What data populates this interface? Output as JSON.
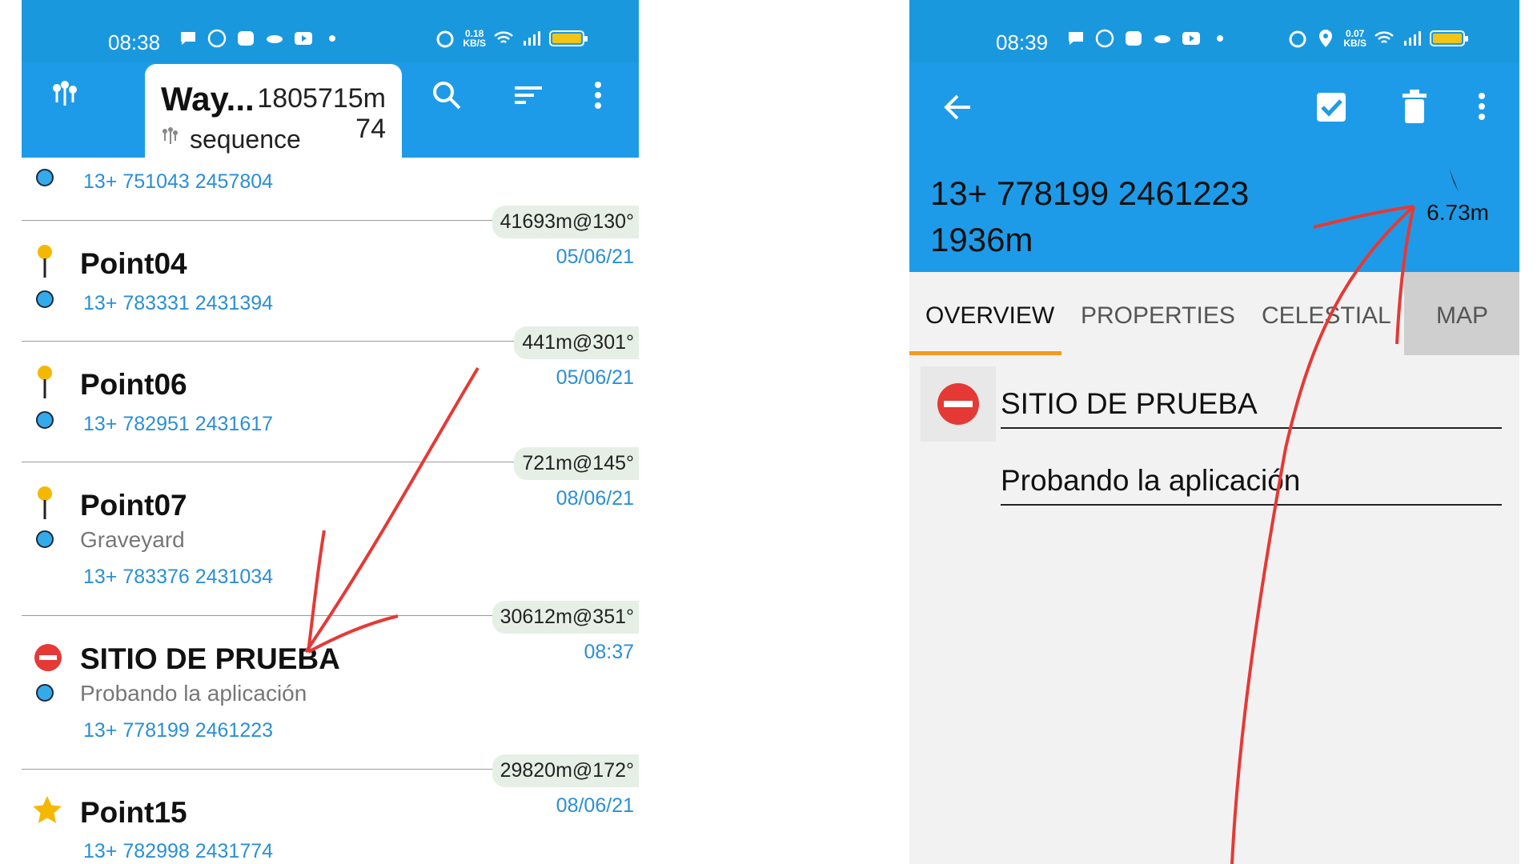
{
  "left": {
    "status": {
      "time": "08:38",
      "speed_top": "0.18",
      "speed_unit": "KB/S"
    },
    "appbar": {
      "title": "Way...",
      "distance": "1805715m",
      "subtitle": "sequence",
      "count": "74"
    },
    "first_coord": "13+ 751043 2457804",
    "rows": [
      {
        "bearing": "41693m@130°",
        "name": "Point04",
        "subtitle": "",
        "coord": "13+ 783331 2431394",
        "date": "05/06/21",
        "icon": "yellow-pin-icon"
      },
      {
        "bearing": "441m@301°",
        "name": "Point06",
        "subtitle": "",
        "coord": "13+ 782951 2431617",
        "date": "05/06/21",
        "icon": "yellow-pin-icon"
      },
      {
        "bearing": "721m@145°",
        "name": "Point07",
        "subtitle": "Graveyard",
        "coord": "13+ 783376 2431034",
        "date": "08/06/21",
        "icon": "yellow-pin-icon"
      },
      {
        "bearing": "30612m@351°",
        "name": "SITIO DE PRUEBA",
        "subtitle": "Probando la aplicación",
        "coord": "13+ 778199 2461223",
        "date": "08:37",
        "icon": "no-entry-icon"
      },
      {
        "bearing": "29820m@172°",
        "name": "Point15",
        "subtitle": "",
        "coord": "13+ 782998 2431774",
        "date": "08/06/21",
        "icon": "star-icon"
      }
    ]
  },
  "right": {
    "status": {
      "time": "08:39",
      "speed_top": "0.07",
      "speed_unit": "KB/S"
    },
    "coord": "13+ 778199 2461223",
    "altitude": "1936m",
    "distance": "6.73m",
    "tabs": [
      "OVERVIEW",
      "PROPERTIES",
      "CELESTIAL",
      "MAP"
    ],
    "name_field": "SITIO DE PRUEBA",
    "description_field": "Probando la aplicación"
  },
  "colors": {
    "appbar": "#1e9be8",
    "statusbar": "#1a98de",
    "link": "#2a8fd6",
    "annotation": "#e53935",
    "tab_indicator": "#f39a1f"
  }
}
